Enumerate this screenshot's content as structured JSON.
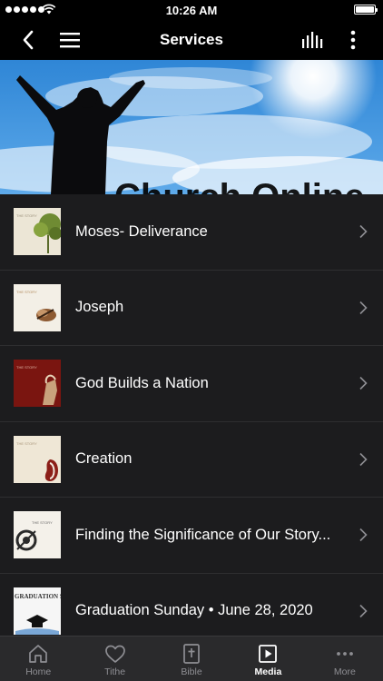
{
  "status_bar": {
    "time": "10:26 AM"
  },
  "header": {
    "title": "Services",
    "back_icon": "chevron-left-icon",
    "menu_icon": "hamburger-menu-icon",
    "audio_icon": "equalizer-icon",
    "more_icon": "vertical-ellipsis-icon"
  },
  "hero": {
    "text": "Church Online"
  },
  "items": [
    {
      "title": "Moses- Deliverance",
      "thumb_label": "THE STORY"
    },
    {
      "title": "Joseph",
      "thumb_label": "THE STORY"
    },
    {
      "title": "God Builds a Nation",
      "thumb_label": "THE STORY"
    },
    {
      "title": "Creation",
      "thumb_label": "THE STORY"
    },
    {
      "title": "Finding the Significance of Our Story...",
      "thumb_label": "THE STORY"
    },
    {
      "title": "Graduation Sunday • June 28, 2020",
      "thumb_label": "GRADUATION SUNDAY"
    }
  ],
  "tabs": [
    {
      "label": "Home",
      "icon": "home-icon"
    },
    {
      "label": "Tithe",
      "icon": "heart-icon"
    },
    {
      "label": "Bible",
      "icon": "bible-icon"
    },
    {
      "label": "Media",
      "icon": "play-icon",
      "active": true
    },
    {
      "label": "More",
      "icon": "more-dots-icon"
    }
  ],
  "colors": {
    "background": "#1c1c1e",
    "bar": "#000000",
    "tabbar": "#2a2a2c",
    "inactive": "#8e8e93"
  }
}
